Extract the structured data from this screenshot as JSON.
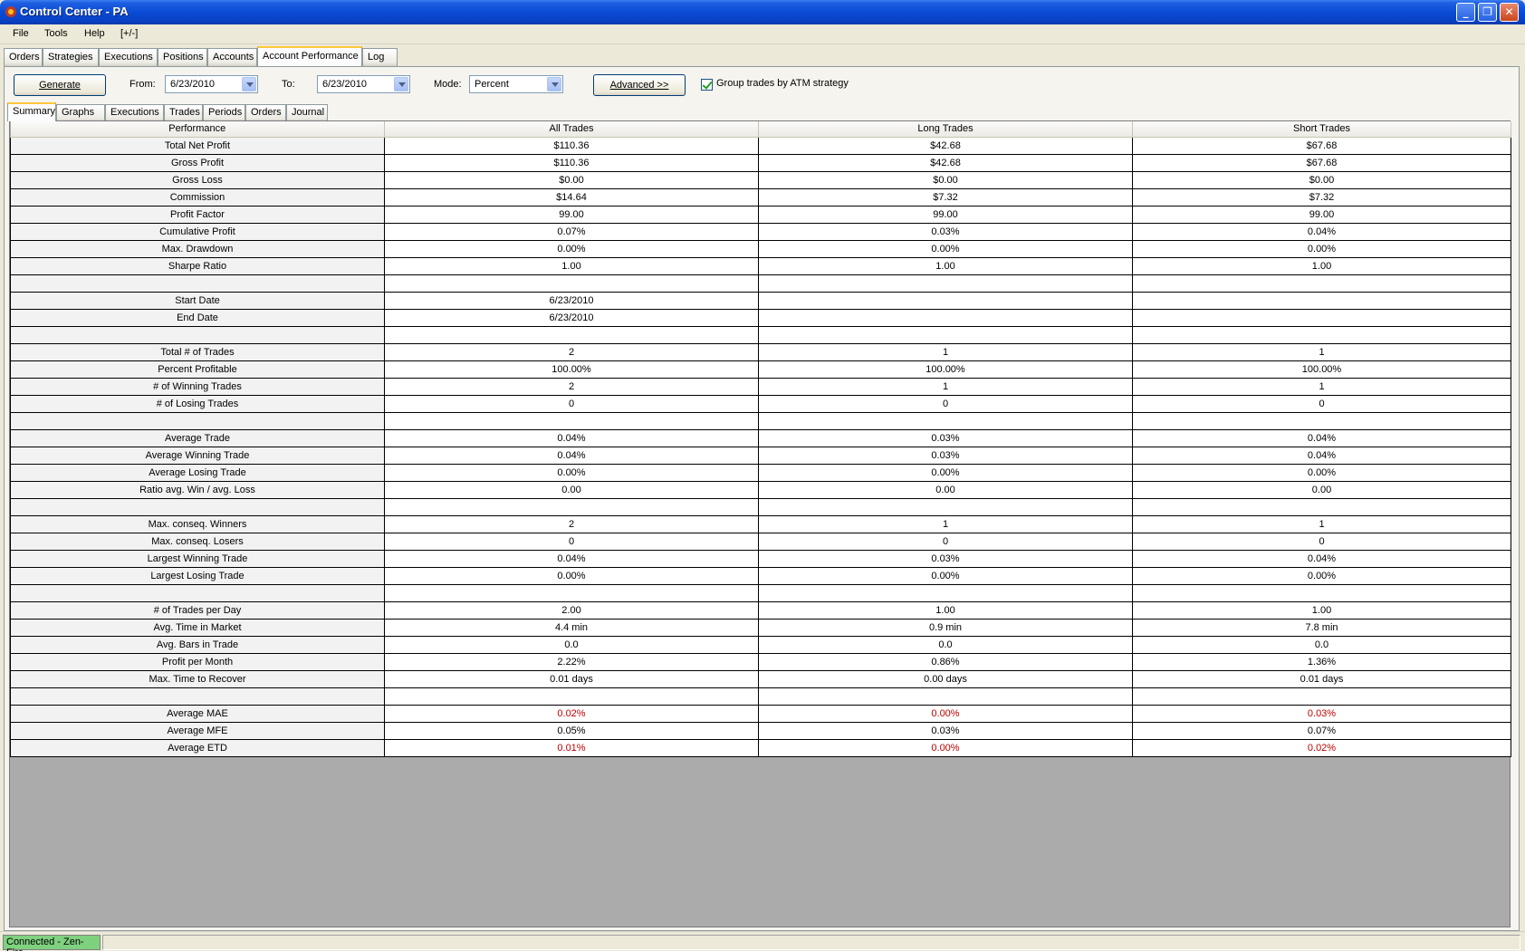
{
  "window": {
    "title": "Control Center - PA",
    "controls": {
      "minimize": "_",
      "maximize": "❐",
      "close": "✕"
    }
  },
  "menu": [
    "File",
    "Tools",
    "Help",
    "[+/-]"
  ],
  "top_tabs": [
    "Orders",
    "Strategies",
    "Executions",
    "Positions",
    "Accounts",
    "Account Performance",
    "Log"
  ],
  "top_tabs_active": "Account Performance",
  "toolbar": {
    "generate_label": "Generate",
    "from_label": "From:",
    "from_value": "6/23/2010",
    "to_label": "To:",
    "to_value": "6/23/2010",
    "mode_label": "Mode:",
    "mode_value": "Percent",
    "advanced_label": "Advanced >>",
    "group_trades_label": "Group trades by ATM strategy",
    "group_trades_checked": true
  },
  "sub_tabs": [
    "Summary",
    "Graphs",
    "Executions",
    "Trades",
    "Periods",
    "Orders",
    "Journal"
  ],
  "sub_tabs_active": "Summary",
  "table": {
    "columns": [
      "Performance",
      "All Trades",
      "Long Trades",
      "Short Trades"
    ],
    "rows": [
      {
        "label": "Total Net Profit",
        "all": "$110.36",
        "long": "$42.68",
        "short": "$67.68"
      },
      {
        "label": "Gross Profit",
        "all": "$110.36",
        "long": "$42.68",
        "short": "$67.68"
      },
      {
        "label": "Gross Loss",
        "all": "$0.00",
        "long": "$0.00",
        "short": "$0.00"
      },
      {
        "label": "Commission",
        "all": "$14.64",
        "long": "$7.32",
        "short": "$7.32"
      },
      {
        "label": "Profit Factor",
        "all": "99.00",
        "long": "99.00",
        "short": "99.00"
      },
      {
        "label": "Cumulative Profit",
        "all": "0.07%",
        "long": "0.03%",
        "short": "0.04%"
      },
      {
        "label": "Max. Drawdown",
        "all": "0.00%",
        "long": "0.00%",
        "short": "0.00%"
      },
      {
        "label": "Sharpe Ratio",
        "all": "1.00",
        "long": "1.00",
        "short": "1.00"
      },
      {
        "label": "",
        "all": "",
        "long": "",
        "short": ""
      },
      {
        "label": "Start Date",
        "all": "6/23/2010",
        "long": "",
        "short": ""
      },
      {
        "label": "End Date",
        "all": "6/23/2010",
        "long": "",
        "short": ""
      },
      {
        "label": "",
        "all": "",
        "long": "",
        "short": ""
      },
      {
        "label": "Total # of Trades",
        "all": "2",
        "long": "1",
        "short": "1"
      },
      {
        "label": "Percent Profitable",
        "all": "100.00%",
        "long": "100.00%",
        "short": "100.00%"
      },
      {
        "label": "# of Winning Trades",
        "all": "2",
        "long": "1",
        "short": "1"
      },
      {
        "label": "# of Losing Trades",
        "all": "0",
        "long": "0",
        "short": "0"
      },
      {
        "label": "",
        "all": "",
        "long": "",
        "short": ""
      },
      {
        "label": "Average Trade",
        "all": "0.04%",
        "long": "0.03%",
        "short": "0.04%"
      },
      {
        "label": "Average Winning Trade",
        "all": "0.04%",
        "long": "0.03%",
        "short": "0.04%"
      },
      {
        "label": "Average Losing Trade",
        "all": "0.00%",
        "long": "0.00%",
        "short": "0.00%"
      },
      {
        "label": "Ratio avg. Win / avg. Loss",
        "all": "0.00",
        "long": "0.00",
        "short": "0.00"
      },
      {
        "label": "",
        "all": "",
        "long": "",
        "short": ""
      },
      {
        "label": "Max. conseq. Winners",
        "all": "2",
        "long": "1",
        "short": "1"
      },
      {
        "label": "Max. conseq. Losers",
        "all": "0",
        "long": "0",
        "short": "0"
      },
      {
        "label": "Largest Winning Trade",
        "all": "0.04%",
        "long": "0.03%",
        "short": "0.04%"
      },
      {
        "label": "Largest Losing Trade",
        "all": "0.00%",
        "long": "0.00%",
        "short": "0.00%"
      },
      {
        "label": "",
        "all": "",
        "long": "",
        "short": ""
      },
      {
        "label": "# of Trades per Day",
        "all": "2.00",
        "long": "1.00",
        "short": "1.00"
      },
      {
        "label": "Avg. Time in Market",
        "all": "4.4 min",
        "long": "0.9 min",
        "short": "7.8 min"
      },
      {
        "label": "Avg. Bars in Trade",
        "all": "0.0",
        "long": "0.0",
        "short": "0.0"
      },
      {
        "label": "Profit per Month",
        "all": "2.22%",
        "long": "0.86%",
        "short": "1.36%"
      },
      {
        "label": "Max. Time to Recover",
        "all": "0.01 days",
        "long": "0.00 days",
        "short": "0.01 days"
      },
      {
        "label": "",
        "all": "",
        "long": "",
        "short": ""
      },
      {
        "label": "Average MAE",
        "all": "0.02%",
        "long": "0.00%",
        "short": "0.03%",
        "negative": true
      },
      {
        "label": "Average MFE",
        "all": "0.05%",
        "long": "0.03%",
        "short": "0.07%"
      },
      {
        "label": "Average ETD",
        "all": "0.01%",
        "long": "0.00%",
        "short": "0.02%",
        "negative": true
      }
    ]
  },
  "status": {
    "connection": "Connected - Zen-Fire"
  },
  "colors": {
    "negative_text": "#c00000",
    "connected_bg": "#7fd17f",
    "active_tab_accent": "#ffc83c"
  }
}
